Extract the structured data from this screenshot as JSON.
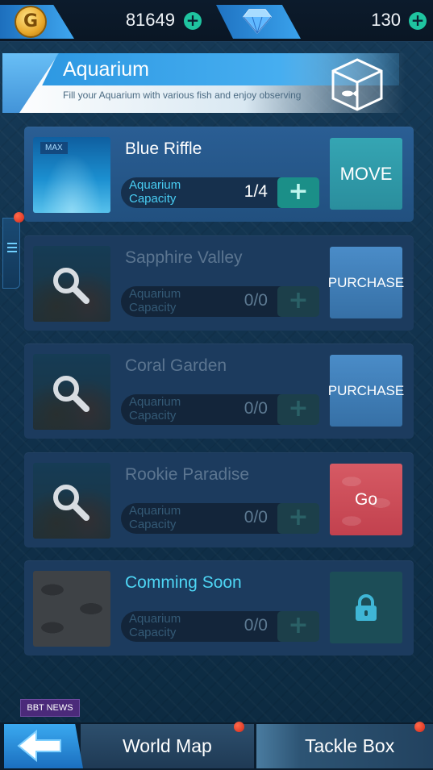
{
  "currency": {
    "coin_icon_letter": "G",
    "coins": "81649",
    "gems": "130",
    "add_symbol": "+"
  },
  "header": {
    "title": "Aquarium",
    "subtitle": "Fill your Aquarium with various fish and enjoy observing"
  },
  "aquariums": [
    {
      "name": "Blue Riffle",
      "badge": "MAX",
      "capacity_label": "Aquarium Capacity",
      "capacity": "1/4",
      "action": "MOVE",
      "state": "owned"
    },
    {
      "name": "Sapphire Valley",
      "capacity_label": "Aquarium Capacity",
      "capacity": "0/0",
      "action": "PURCHASE",
      "state": "locked"
    },
    {
      "name": "Coral Garden",
      "capacity_label": "Aquarium Capacity",
      "capacity": "0/0",
      "action": "PURCHASE",
      "state": "locked"
    },
    {
      "name": "Rookie Paradise",
      "capacity_label": "Aquarium Capacity",
      "capacity": "0/0",
      "action": "Go",
      "state": "locked"
    },
    {
      "name": "Comming Soon",
      "capacity_label": "Aquarium Capacity",
      "capacity": "0/0",
      "action_icon": "lock-icon",
      "state": "coming-soon"
    }
  ],
  "news_label": "BBT NEWS",
  "bottom_nav": {
    "back_icon": "arrow-left-icon",
    "world_map": "World Map",
    "tackle_box": "Tackle Box"
  },
  "colors": {
    "background": "#123049",
    "accent_blue": "#2a95e0",
    "move_button": "#35a5b3",
    "purchase_button": "#4a8cc8",
    "go_button": "#d65a64",
    "cyan_text": "#4ed6f5",
    "notification_dot": "#d4281a"
  }
}
